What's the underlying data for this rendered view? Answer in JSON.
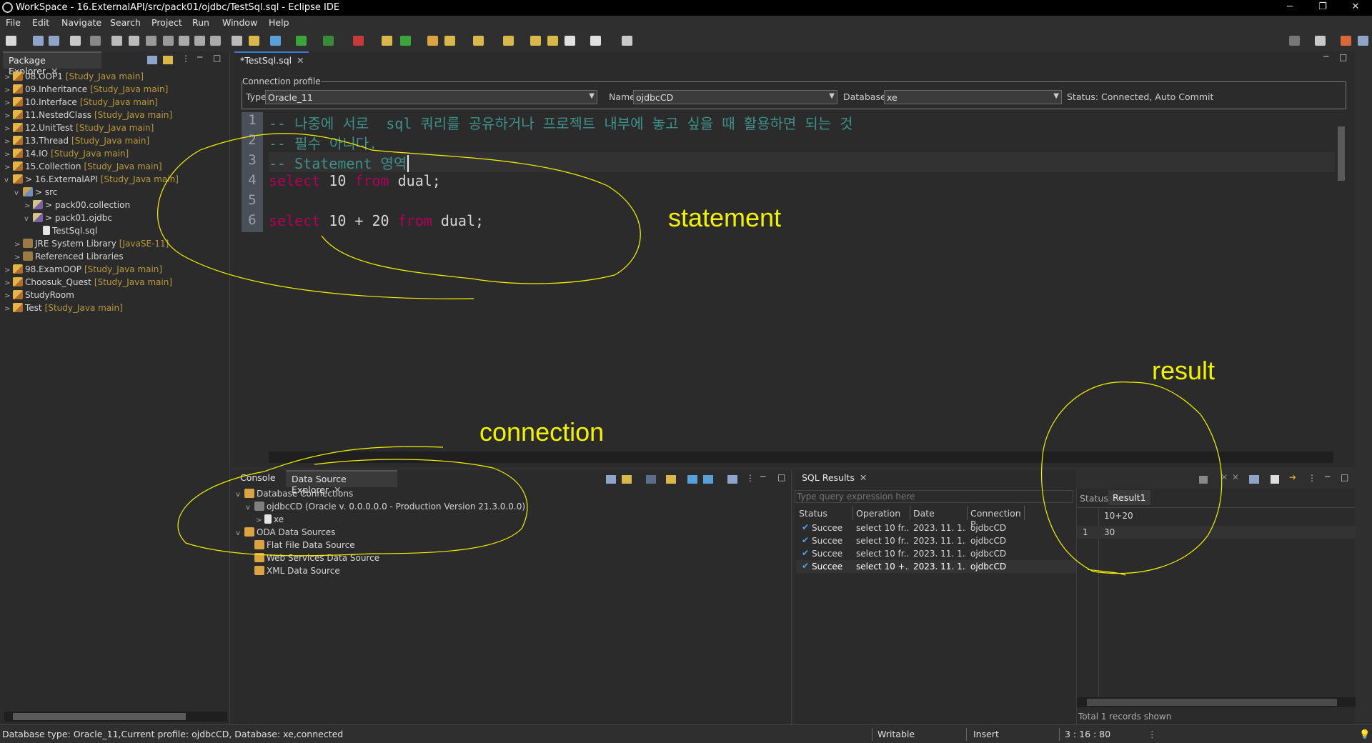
{
  "window": {
    "title": "WorkSpace - 16.ExternalAPI/src/pack01/ojdbc/TestSql.sql - Eclipse IDE",
    "min": "─",
    "max": "❐",
    "close": "✕"
  },
  "menu": [
    "File",
    "Edit",
    "Navigate",
    "Search",
    "Project",
    "Run",
    "Window",
    "Help"
  ],
  "package_explorer": {
    "tab": "Package Explorer",
    "items": [
      {
        "indent": 0,
        "arrow": ">",
        "icon": "proj",
        "name": "08.OOP1",
        "tag": "[Study_Java main]"
      },
      {
        "indent": 0,
        "arrow": ">",
        "icon": "proj",
        "name": "09.Inheritance",
        "tag": "[Study_Java main]"
      },
      {
        "indent": 0,
        "arrow": ">",
        "icon": "proj",
        "name": "10.Interface",
        "tag": "[Study_Java main]"
      },
      {
        "indent": 0,
        "arrow": ">",
        "icon": "proj",
        "name": "11.NestedClass",
        "tag": "[Study_Java main]"
      },
      {
        "indent": 0,
        "arrow": ">",
        "icon": "proj",
        "name": "12.UnitTest",
        "tag": "[Study_Java main]"
      },
      {
        "indent": 0,
        "arrow": ">",
        "icon": "proj",
        "name": "13.Thread",
        "tag": "[Study_Java main]"
      },
      {
        "indent": 0,
        "arrow": ">",
        "icon": "proj",
        "name": "14.IO",
        "tag": "[Study_Java main]"
      },
      {
        "indent": 0,
        "arrow": ">",
        "icon": "proj",
        "name": "15.Collection",
        "tag": "[Study_Java main]"
      },
      {
        "indent": 0,
        "arrow": "v",
        "icon": "proj",
        "name": "> 16.ExternalAPI",
        "tag": "[Study_Java main]"
      },
      {
        "indent": 1,
        "arrow": "v",
        "icon": "src",
        "name": "> src",
        "tag": ""
      },
      {
        "indent": 2,
        "arrow": ">",
        "icon": "pkg",
        "name": "> pack00.collection",
        "tag": ""
      },
      {
        "indent": 2,
        "arrow": "v",
        "icon": "pkg",
        "name": "> pack01.ojdbc",
        "tag": ""
      },
      {
        "indent": 3,
        "arrow": "",
        "icon": "file",
        "name": "TestSql.sql",
        "tag": ""
      },
      {
        "indent": 1,
        "arrow": ">",
        "icon": "lib",
        "name": "JRE System Library",
        "tag": "[JavaSE-11]"
      },
      {
        "indent": 1,
        "arrow": ">",
        "icon": "lib",
        "name": "Referenced Libraries",
        "tag": ""
      },
      {
        "indent": 0,
        "arrow": ">",
        "icon": "proj",
        "name": "98.ExamOOP",
        "tag": "[Study_Java main]"
      },
      {
        "indent": 0,
        "arrow": ">",
        "icon": "proj",
        "name": "Choosuk_Quest",
        "tag": "[Study_Java main]"
      },
      {
        "indent": 0,
        "arrow": ">",
        "icon": "proj",
        "name": "StudyRoom",
        "tag": ""
      },
      {
        "indent": 0,
        "arrow": ">",
        "icon": "proj",
        "name": "Test",
        "tag": "[Study_Java main]"
      }
    ]
  },
  "editor": {
    "tab": "*TestSql.sql",
    "connection_profile": {
      "legend": "Connection profile",
      "type_label": "Type:",
      "type_value": "Oracle_11",
      "name_label": "Name:",
      "name_value": "ojdbcCD",
      "database_label": "Database:",
      "database_value": "xe",
      "status": "Status: Connected, Auto Commit"
    },
    "lines": [
      {
        "n": "1",
        "parts": [
          {
            "c": "cm",
            "t": "-- 나중에 서로  sql 쿼리를 공유하거나 프로젝트 내부에 놓고 싶을 때 활용하면 되는 것"
          }
        ]
      },
      {
        "n": "2",
        "parts": [
          {
            "c": "cm",
            "t": "-- 필수 아니다."
          }
        ]
      },
      {
        "n": "3",
        "parts": [
          {
            "c": "cm",
            "t": "-- Statement 영역"
          }
        ]
      },
      {
        "n": "4",
        "parts": [
          {
            "c": "kw",
            "t": "select"
          },
          {
            "c": "tx",
            "t": " 10 "
          },
          {
            "c": "kw",
            "t": "from"
          },
          {
            "c": "tx",
            "t": " dual;"
          }
        ]
      },
      {
        "n": "5",
        "parts": []
      },
      {
        "n": "6",
        "parts": [
          {
            "c": "kw",
            "t": "select"
          },
          {
            "c": "tx",
            "t": " 10 + 20 "
          },
          {
            "c": "kw",
            "t": "from"
          },
          {
            "c": "tx",
            "t": " dual;"
          }
        ]
      }
    ]
  },
  "console": {
    "tab1": "Console",
    "tab2": "Data Source Explorer",
    "tree": [
      {
        "indent": 0,
        "arrow": "v",
        "icon": "folder",
        "name": "Database Connections"
      },
      {
        "indent": 1,
        "arrow": "v",
        "icon": "db",
        "name": "ojdbcCD (Oracle v. 0.0.0.0.0 - Production Version 21.3.0.0.0)"
      },
      {
        "indent": 2,
        "arrow": ">",
        "icon": "file",
        "name": "xe"
      },
      {
        "indent": 0,
        "arrow": "v",
        "icon": "folder",
        "name": "ODA Data Sources"
      },
      {
        "indent": 1,
        "arrow": "",
        "icon": "folder",
        "name": "Flat File Data Source"
      },
      {
        "indent": 1,
        "arrow": "",
        "icon": "folder",
        "name": "Web Services Data Source"
      },
      {
        "indent": 1,
        "arrow": "",
        "icon": "folder",
        "name": "XML Data Source"
      }
    ]
  },
  "sql_results": {
    "tab": "SQL Results",
    "filter_placeholder": "Type query expression here",
    "columns": [
      "Status",
      "Operation",
      "Date",
      "Connection P"
    ],
    "rows": [
      [
        "Succee",
        "select 10 fr...",
        "2023. 11. 1...",
        "ojdbcCD"
      ],
      [
        "Succee",
        "select 10 fr...",
        "2023. 11. 1...",
        "ojdbcCD"
      ],
      [
        "Succee",
        "select 10 fr...",
        "2023. 11. 1...",
        "ojdbcCD"
      ],
      [
        "Succee",
        "select 10 +...",
        "2023. 11. 1...",
        "ojdbcCD"
      ]
    ],
    "detail_tabs": [
      "Status",
      "Result1"
    ],
    "result_header": "10+20",
    "result_row_num": "1",
    "result_value": "30",
    "total": "Total 1 records shown"
  },
  "statusbar": {
    "info": "Database type: Oracle_11,Current profile: ojdbcCD, Database: xe,connected",
    "writable": "Writable",
    "insert": "Insert",
    "position": "3 : 16 : 80"
  },
  "annotations": {
    "statement": "statement",
    "connection": "connection",
    "result": "result",
    "color": "#f3f300"
  }
}
